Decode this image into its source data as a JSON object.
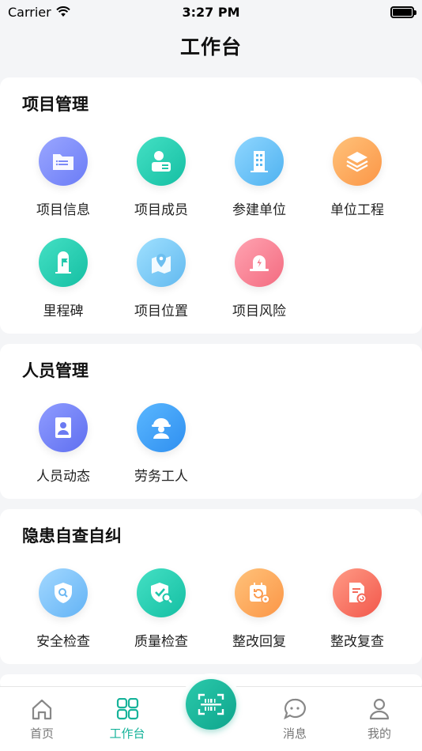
{
  "status_bar": {
    "carrier": "Carrier",
    "time": "3:27 PM"
  },
  "header": {
    "title": "工作台"
  },
  "sections": [
    {
      "title": "项目管理",
      "items": [
        {
          "label": "项目信息",
          "icon": "folder-icon",
          "color_from": "#9aa6ff",
          "color_to": "#6b7cf6"
        },
        {
          "label": "项目成员",
          "icon": "member-card-icon",
          "color_from": "#44e0c4",
          "color_to": "#15bfa3"
        },
        {
          "label": "参建单位",
          "icon": "building-icon",
          "color_from": "#8fd6ff",
          "color_to": "#4fb2f0"
        },
        {
          "label": "单位工程",
          "icon": "layers-icon",
          "color_from": "#ffc27a",
          "color_to": "#fb9647"
        },
        {
          "label": "里程碑",
          "icon": "milestone-flag-icon",
          "color_from": "#44e0c4",
          "color_to": "#15bfa3"
        },
        {
          "label": "项目位置",
          "icon": "map-pin-icon",
          "color_from": "#9fe0ff",
          "color_to": "#62b9ef"
        },
        {
          "label": "项目风险",
          "icon": "alarm-icon",
          "color_from": "#ffa3b1",
          "color_to": "#f36b80"
        }
      ]
    },
    {
      "title": "人员管理",
      "items": [
        {
          "label": "人员动态",
          "icon": "person-badge-icon",
          "color_from": "#8f9cff",
          "color_to": "#5f6ff0"
        },
        {
          "label": "劳务工人",
          "icon": "worker-helmet-icon",
          "color_from": "#5ab7ff",
          "color_to": "#2f8ff0"
        }
      ]
    },
    {
      "title": "隐患自查自纠",
      "items": [
        {
          "label": "安全检查",
          "icon": "shield-search-icon",
          "color_from": "#a3d8ff",
          "color_to": "#63b3f5"
        },
        {
          "label": "质量检查",
          "icon": "shield-check-icon",
          "color_from": "#44e0c4",
          "color_to": "#15bfa3"
        },
        {
          "label": "整改回复",
          "icon": "calendar-refresh-icon",
          "color_from": "#ffc27a",
          "color_to": "#fb9647"
        },
        {
          "label": "整改复查",
          "icon": "document-recheck-icon",
          "color_from": "#ff9b86",
          "color_to": "#f2574b"
        }
      ]
    }
  ],
  "tabbar": {
    "tabs": [
      {
        "label": "首页",
        "icon": "home-icon",
        "active": false
      },
      {
        "label": "工作台",
        "icon": "grid-icon",
        "active": true
      },
      {
        "label": "消息",
        "icon": "message-icon",
        "active": false
      },
      {
        "label": "我的",
        "icon": "user-icon",
        "active": false
      }
    ],
    "center_icon": "scan-icon"
  },
  "colors": {
    "accent": "#16b39a",
    "background": "#f4f5f7"
  }
}
